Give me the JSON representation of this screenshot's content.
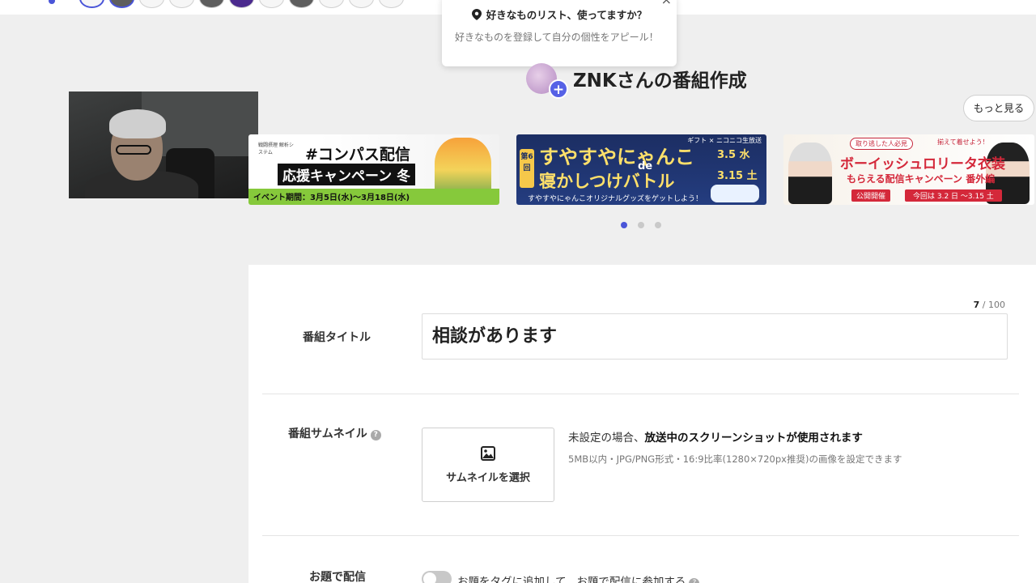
{
  "popup": {
    "title": "好きなものリスト、使ってますか？",
    "body": "好きなものを登録して自分の個性をアピール！",
    "close": "×"
  },
  "heading": {
    "title": "ZNKさんの番組作成",
    "plus": "+"
  },
  "more_button": "もっと見る",
  "banners": [
    {
      "title": "#コンパス配信",
      "subtitle": "応援キャンペーン 冬",
      "period": "イベント期間：3月5日(水)～3月18日(水)",
      "logo": "戦闘摂理 解析システム"
    },
    {
      "badge": "第6回",
      "title": "すやすやにゃんこ",
      "de": "de",
      "title2": "寝かしつけバトル",
      "date1": "3.5 水",
      "date2": "3.15 土",
      "footer": "すやすやにゃんこオリジナルグッズをゲットしよう！",
      "top": "ギフト × ニコニコ生放送"
    },
    {
      "tag": "取り逃した人必見",
      "tag2": "揃えて着せよう！",
      "title": "ボーイッシュロリータ衣装",
      "subtitle": "もらえる配信キャンペーン 番外編",
      "chip1": "公開開催",
      "chip2": "今回は 3.2 日 ～3.15 土"
    }
  ],
  "carousel": {
    "active_index": 0,
    "count": 3
  },
  "form": {
    "counter_current": "7",
    "counter_sep": " / ",
    "counter_max": "100",
    "title_label": "番組タイトル",
    "title_value": "相談があります",
    "thumbnail_label": "番組サムネイル",
    "thumbnail_button": "サムネイルを選択",
    "thumbnail_note_prefix": "未設定の場合、",
    "thumbnail_note_bold": "放送中のスクリーンショットが使用されます",
    "thumbnail_sub": "5MB以内・JPG/PNG形式・16:9比率(1280×720px推奨)の画像を設定できます",
    "topic_label": "お題で配信",
    "topic_toggle_label": "お題をタグに追加して、お題で配信に参加する",
    "topic_toggle_on": false,
    "help": "?"
  },
  "colors": {
    "accent": "#4a55d8",
    "background": "#efefef"
  }
}
